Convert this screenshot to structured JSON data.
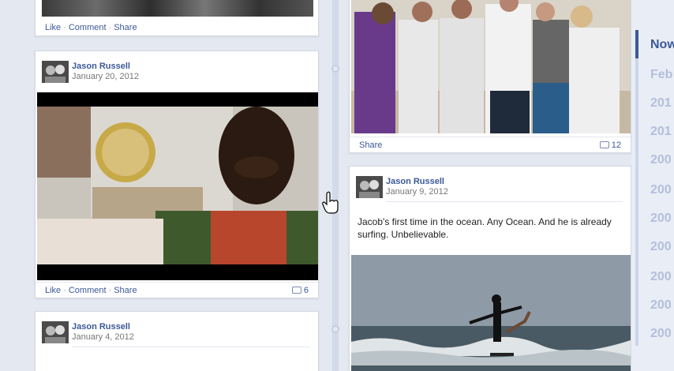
{
  "posts": {
    "top_left": {
      "like": "Like",
      "comment": "Comment",
      "share": "Share"
    },
    "video_post": {
      "author": "Jason Russell",
      "date": "January 20, 2012",
      "like": "Like",
      "comment": "Comment",
      "share": "Share",
      "comment_count": "6"
    },
    "group_photo": {
      "share": "Share",
      "comment_count": "12"
    },
    "ocean_post": {
      "author": "Jason Russell",
      "date": "January 9, 2012",
      "text": "Jacob's first time in the ocean. Any Ocean. And he is already surfing. Unbelievable."
    },
    "bottom_post": {
      "author": "Jason Russell",
      "date": "January 4, 2012"
    }
  },
  "timeline_nav": {
    "items": [
      "Now",
      "Feb",
      "201",
      "201",
      "200",
      "200",
      "200",
      "200",
      "200",
      "200",
      "200",
      "200"
    ],
    "active_index": 0
  },
  "colors": {
    "link": "#3b5998",
    "muted_year": "#b3bfdb",
    "background": "#e4e8f1"
  },
  "icons": [
    "comment-bubble-icon",
    "hand-pointer-icon",
    "avatar-photo"
  ]
}
